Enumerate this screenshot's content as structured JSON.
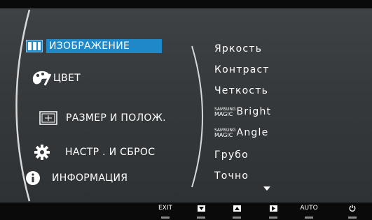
{
  "main_menu": [
    {
      "label": "ИЗОБРАЖЕНИЕ",
      "icon": "picture-icon",
      "selected": true
    },
    {
      "label": "ЦВЕТ",
      "icon": "palette-icon",
      "selected": false
    },
    {
      "label": "РАЗМЕР И ПОЛОЖ.",
      "icon": "size-position-icon",
      "selected": false
    },
    {
      "label": "НАСТР . И СБРОС",
      "icon": "gear-icon",
      "selected": false
    },
    {
      "label": "ИНФОРМАЦИЯ",
      "icon": "info-icon",
      "selected": false
    }
  ],
  "submenu": {
    "brightness": "Яркость",
    "contrast": "Контраст",
    "sharpness": "Четкость",
    "magic_brand": "SAMSUNG",
    "magic_word": "MAGIC",
    "magic_bright": "Bright",
    "magic_angle": "Angle",
    "coarse": "Грубо",
    "fine": "Точно"
  },
  "buttons": {
    "exit": "EXIT",
    "auto": "AUTO"
  },
  "colors": {
    "selection": "#1e88c8",
    "panel": "#3a3e41",
    "text": "#ffffff"
  }
}
